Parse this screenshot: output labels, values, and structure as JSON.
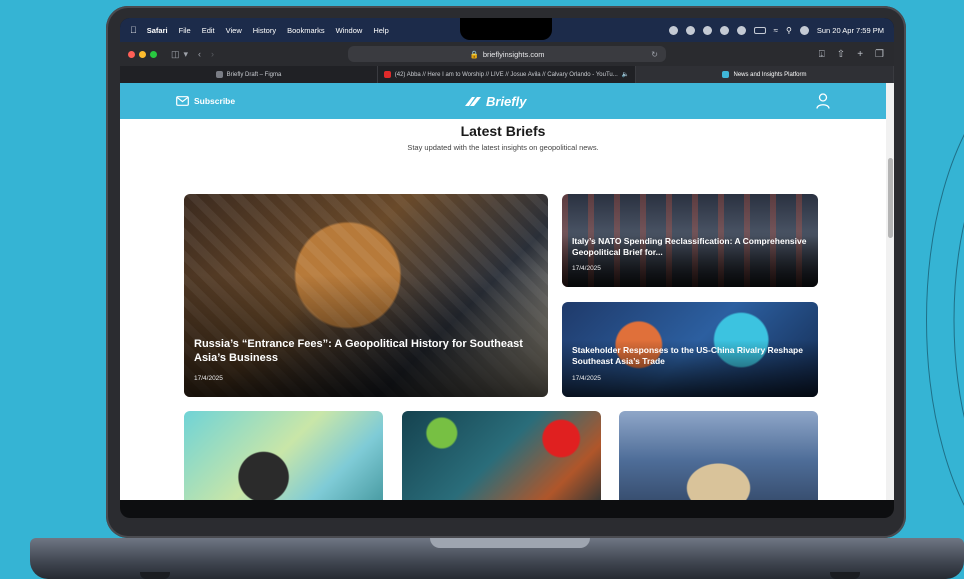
{
  "menubar": {
    "items": [
      "Safari",
      "File",
      "Edit",
      "View",
      "History",
      "Bookmarks",
      "Window",
      "Help"
    ],
    "datetime": "Sun 20 Apr  7:59 PM"
  },
  "toolbar": {
    "url": "brieflyinsights.com"
  },
  "tabs": [
    {
      "label": "Briefly Draft – Figma",
      "color": "#7a7d85"
    },
    {
      "label": "(42) Abba // Here I am to Worship // LIVE // Josue Avila // Calvary Orlando - YouTu...",
      "color": "#e02a2a"
    },
    {
      "label": "News and Insights Platform",
      "color": "#3fb6d8"
    }
  ],
  "header": {
    "subscribe_label": "Subscribe",
    "brand": "Briefly"
  },
  "page": {
    "title": "Latest Briefs",
    "subtitle": "Stay updated with the latest insights on geopolitical news."
  },
  "cards": [
    {
      "title": "Russia’s “Entrance Fees”: A Geopolitical History for Southeast Asia’s Business",
      "date": "17/4/2025"
    },
    {
      "title": "Italy’s NATO Spending Reclassification: A Comprehensive Geopolitical Brief for...",
      "date": "17/4/2025"
    },
    {
      "title": "Stakeholder Responses to the US-China Rivalry Reshape Southeast Asia’s Trade",
      "date": "17/4/2025"
    }
  ],
  "colors": {
    "background": "#35b4d4",
    "header": "#3fb6d8",
    "menubar": "#1c2b4a"
  }
}
